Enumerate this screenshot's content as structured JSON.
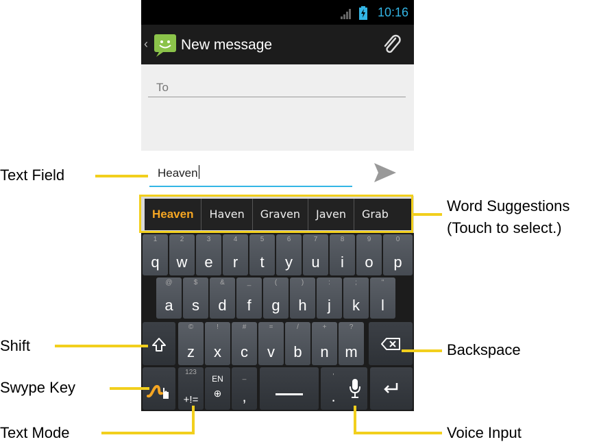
{
  "status_bar": {
    "time": "10:16",
    "signal_icon": "signal-icon",
    "battery_icon": "battery-charging-icon"
  },
  "action_bar": {
    "back_icon": "back-chevron-icon",
    "app_icon": "messaging-app-icon",
    "title": "New message",
    "attach_icon": "paperclip-icon"
  },
  "recipient": {
    "placeholder": "To"
  },
  "compose": {
    "text": "Heaven",
    "send_icon": "send-icon"
  },
  "suggestions": [
    "Heaven",
    "Haven",
    "Graven",
    "Javen",
    "Grab"
  ],
  "keyboard": {
    "row1": [
      {
        "main": "q",
        "sub": "1"
      },
      {
        "main": "w",
        "sub": "2"
      },
      {
        "main": "e",
        "sub": "3"
      },
      {
        "main": "r",
        "sub": "4"
      },
      {
        "main": "t",
        "sub": "5"
      },
      {
        "main": "y",
        "sub": "6"
      },
      {
        "main": "u",
        "sub": "7"
      },
      {
        "main": "i",
        "sub": "8"
      },
      {
        "main": "o",
        "sub": "9"
      },
      {
        "main": "p",
        "sub": "0"
      }
    ],
    "row2": [
      {
        "main": "a",
        "sub": "@"
      },
      {
        "main": "s",
        "sub": "$"
      },
      {
        "main": "d",
        "sub": "&"
      },
      {
        "main": "f",
        "sub": "_"
      },
      {
        "main": "g",
        "sub": "("
      },
      {
        "main": "h",
        "sub": ")"
      },
      {
        "main": "j",
        "sub": ":"
      },
      {
        "main": "k",
        "sub": ";"
      },
      {
        "main": "l",
        "sub": "\""
      }
    ],
    "row3": [
      {
        "main": "z",
        "sub": "©"
      },
      {
        "main": "x",
        "sub": "!"
      },
      {
        "main": "c",
        "sub": "#"
      },
      {
        "main": "v",
        "sub": "="
      },
      {
        "main": "b",
        "sub": "/"
      },
      {
        "main": "n",
        "sub": "+"
      },
      {
        "main": "m",
        "sub": "?"
      }
    ],
    "shift_icon": "shift-icon",
    "backspace_icon": "backspace-icon",
    "swype_icon": "swype-key-icon",
    "text_mode": {
      "sub": "123",
      "main": "+!="
    },
    "language": {
      "label": "EN",
      "icon": "globe-icon"
    },
    "comma": {
      "sub": "_",
      "main": ","
    },
    "space_icon": "space-bar-icon",
    "period": {
      "sub": "'",
      "main": "."
    },
    "mic_icon": "microphone-icon",
    "enter_icon": "enter-icon"
  },
  "callouts": {
    "text_field": "Text Field",
    "word_suggestions": "Word Suggestions",
    "word_suggestions_note": "(Touch to select.)",
    "shift": "Shift",
    "backspace": "Backspace",
    "swype_key": "Swype Key",
    "text_mode": "Text Mode",
    "voice_input": "Voice Input"
  },
  "colors": {
    "accent_blue": "#33b5e5",
    "suggestion_highlight": "#f5a623",
    "callout_yellow": "#f2cf1d"
  }
}
